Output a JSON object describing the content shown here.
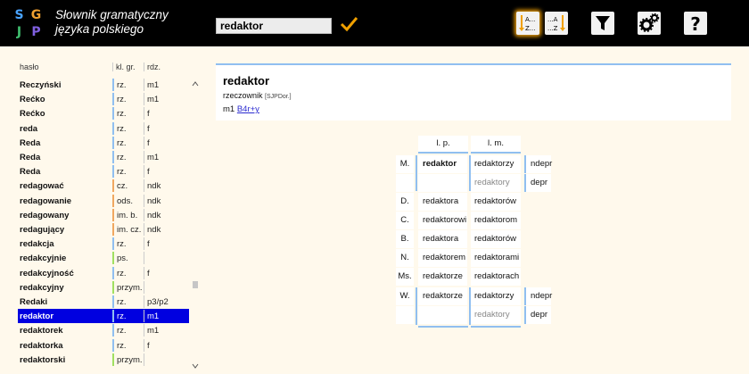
{
  "app": {
    "logo_letters": [
      "S",
      "G",
      "J",
      "P"
    ],
    "logo_colors": [
      "#4aa3ff",
      "#f0a030",
      "#40c070",
      "#8060e0"
    ],
    "title_line1": "Słownik gramatyczny",
    "title_line2": "języka polskiego"
  },
  "search": {
    "value": "redaktor"
  },
  "toolbar": {
    "sort_az_label_top": "A...",
    "sort_az_label_bottom": "Z...",
    "sort_za_label_top": "...A",
    "sort_za_label_bottom": "...Z",
    "accent": "#f0a000"
  },
  "list": {
    "headers": {
      "headword": "hasło",
      "class": "kl. gr.",
      "gender": "rdz."
    },
    "rows": [
      {
        "h": "Reczyński",
        "k": "rz.",
        "r": "m1",
        "c": "#90bff0"
      },
      {
        "h": "Rećko",
        "k": "rz.",
        "r": "m1",
        "c": "#90bff0"
      },
      {
        "h": "Rećko",
        "k": "rz.",
        "r": "f",
        "c": "#90bff0"
      },
      {
        "h": "reda",
        "k": "rz.",
        "r": "f",
        "c": "#90bff0"
      },
      {
        "h": "Reda",
        "k": "rz.",
        "r": "f",
        "c": "#90bff0"
      },
      {
        "h": "Reda",
        "k": "rz.",
        "r": "m1",
        "c": "#90bff0"
      },
      {
        "h": "Reda",
        "k": "rz.",
        "r": "f",
        "c": "#90bff0"
      },
      {
        "h": "redagować",
        "k": "cz.",
        "r": "ndk",
        "c": "#f0a860"
      },
      {
        "h": "redagowanie",
        "k": "ods.",
        "r": "ndk",
        "c": "#f0a860"
      },
      {
        "h": "redagowany",
        "k": "im. b.",
        "r": "ndk",
        "c": "#f0a860"
      },
      {
        "h": "redagujący",
        "k": "im. cz.",
        "r": "ndk",
        "c": "#f0a860"
      },
      {
        "h": "redakcja",
        "k": "rz.",
        "r": "f",
        "c": "#90bff0"
      },
      {
        "h": "redakcyjnie",
        "k": "ps.",
        "r": "",
        "c": "#a0e060"
      },
      {
        "h": "redakcyjność",
        "k": "rz.",
        "r": "f",
        "c": "#90bff0"
      },
      {
        "h": "redakcyjny",
        "k": "przym.",
        "r": "",
        "c": "#a0e060"
      },
      {
        "h": "Redaki",
        "k": "rz.",
        "r": "p3/p2",
        "c": "#90bff0"
      },
      {
        "h": "redaktor",
        "k": "rz.",
        "r": "m1",
        "c": "#90bff0",
        "selected": true
      },
      {
        "h": "redaktorek",
        "k": "rz.",
        "r": "m1",
        "c": "#90bff0"
      },
      {
        "h": "redaktorka",
        "k": "rz.",
        "r": "f",
        "c": "#90bff0"
      },
      {
        "h": "redaktorski",
        "k": "przym.",
        "r": "",
        "c": "#a0e060"
      }
    ]
  },
  "entry": {
    "lemma": "redaktor",
    "pos": "rzeczownik",
    "source": "[SJPDor.]",
    "gender": "m1",
    "pattern": "B4r+y"
  },
  "paradigm": {
    "col_sg": "l. p.",
    "col_pl": "l. m.",
    "rows": [
      {
        "case": "M.",
        "sg": "redaktor",
        "pl": "redaktorzy",
        "tag": "ndepr",
        "bold": true
      },
      {
        "case": "",
        "sg": "",
        "pl": "redaktory",
        "tag": "depr",
        "gray": true
      },
      {
        "case": "D.",
        "sg": "redaktora",
        "pl": "redaktorów"
      },
      {
        "case": "C.",
        "sg": "redaktorowi",
        "pl": "redaktorom"
      },
      {
        "case": "B.",
        "sg": "redaktora",
        "pl": "redaktorów"
      },
      {
        "case": "N.",
        "sg": "redaktorem",
        "pl": "redaktorami"
      },
      {
        "case": "Ms.",
        "sg": "redaktorze",
        "pl": "redaktorach"
      },
      {
        "case": "W.",
        "sg": "redaktorze",
        "pl": "redaktorzy",
        "tag": "ndepr"
      },
      {
        "case": "",
        "sg": "",
        "pl": "redaktory",
        "tag": "depr",
        "gray": true
      }
    ]
  }
}
